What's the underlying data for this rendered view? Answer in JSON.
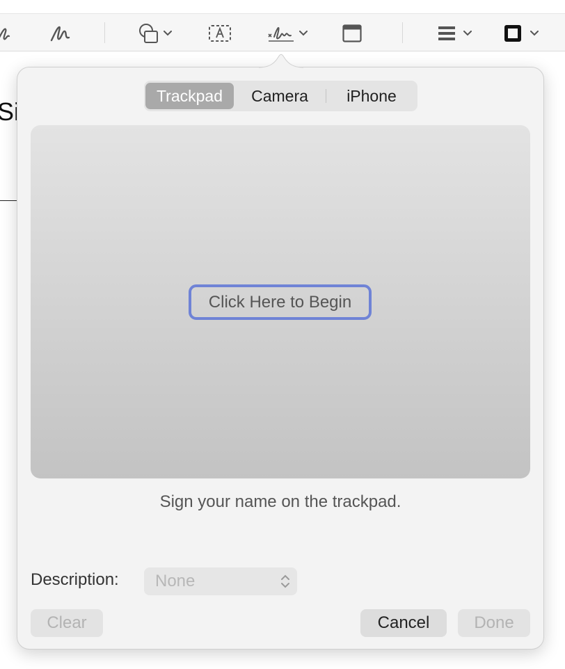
{
  "toolbar": {
    "icons": [
      "sketch-icon",
      "draw-icon",
      "shapes-icon",
      "text-box-icon",
      "sign-icon",
      "note-icon",
      "line-style-icon",
      "border-color-icon"
    ]
  },
  "document": {
    "partial_text": "Sig"
  },
  "signature_popover": {
    "tabs": [
      {
        "label": "Trackpad",
        "selected": true
      },
      {
        "label": "Camera",
        "selected": false
      },
      {
        "label": "iPhone",
        "selected": false
      }
    ],
    "begin_button_label": "Click Here to Begin",
    "hint": "Sign your name on the trackpad.",
    "description_label": "Description:",
    "description_value": "None",
    "clear_label": "Clear",
    "cancel_label": "Cancel",
    "done_label": "Done"
  },
  "colors": {
    "focus_ring": "#6f83d6",
    "selected_tab": "#a9a9a9",
    "popover_bg": "#f3f3f3"
  }
}
